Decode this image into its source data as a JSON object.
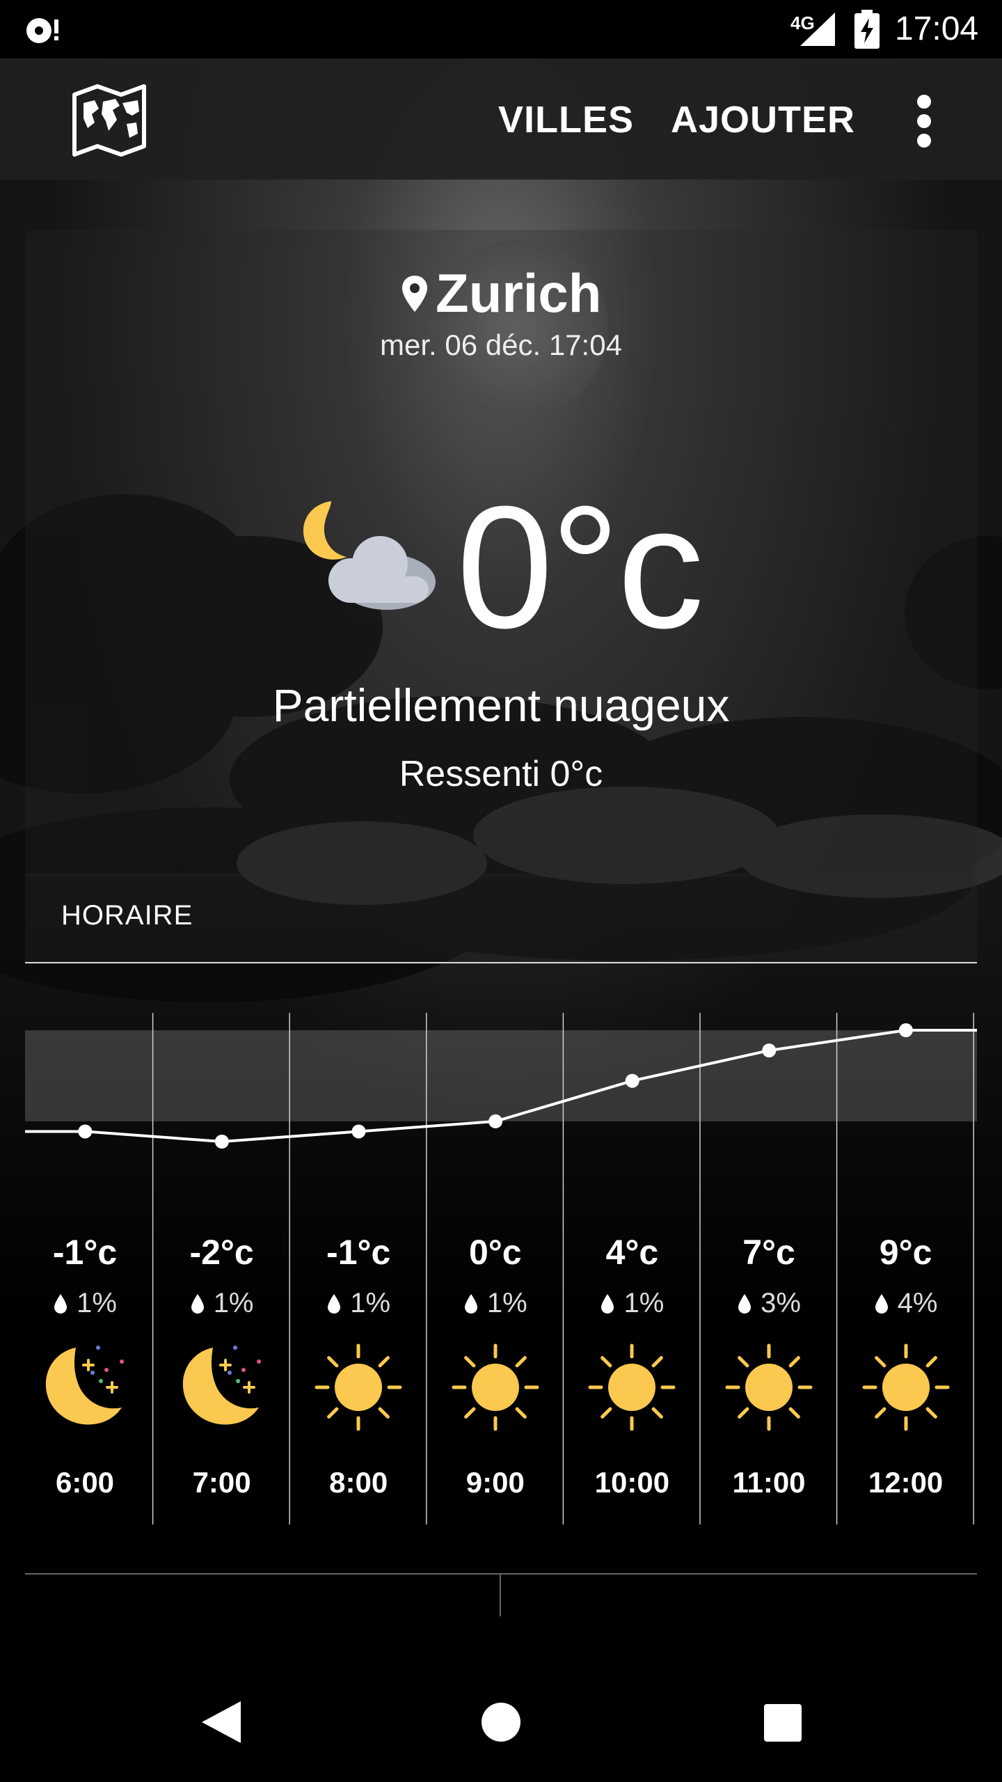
{
  "status_bar": {
    "network": "4G",
    "time": "17:04",
    "left_icon": "notification-disc-icon",
    "signal_icon": "cell-signal-icon",
    "battery_icon": "battery-charging-icon"
  },
  "app_bar": {
    "logo_icon": "world-map-icon",
    "nav_villes": "VILLES",
    "nav_ajouter": "AJOUTER",
    "menu_icon": "more-vert-icon"
  },
  "current": {
    "city": "Zurich",
    "datetime": "mer. 06 déc. 17:04",
    "temperature": "0°c",
    "condition": "Partiellement nuageux",
    "feels_like": "Ressenti 0°c",
    "condition_icon": "moon-cloud-icon"
  },
  "hourly": {
    "title": "HORAIRE",
    "items": [
      {
        "hour": "6:00",
        "temp": "-1°c",
        "precip": "1%",
        "icon": "moon-stars-icon"
      },
      {
        "hour": "7:00",
        "temp": "-2°c",
        "precip": "1%",
        "icon": "moon-stars-icon"
      },
      {
        "hour": "8:00",
        "temp": "-1°c",
        "precip": "1%",
        "icon": "sun-icon"
      },
      {
        "hour": "9:00",
        "temp": "0°c",
        "precip": "1%",
        "icon": "sun-icon"
      },
      {
        "hour": "10:00",
        "temp": "4°c",
        "precip": "1%",
        "icon": "sun-icon"
      },
      {
        "hour": "11:00",
        "temp": "7°c",
        "precip": "3%",
        "icon": "sun-icon"
      },
      {
        "hour": "12:00",
        "temp": "9°c",
        "precip": "4%",
        "icon": "sun-icon"
      }
    ]
  },
  "chart_data": {
    "type": "line",
    "x": [
      "6:00",
      "7:00",
      "8:00",
      "9:00",
      "10:00",
      "11:00",
      "12:00"
    ],
    "series": [
      {
        "values": [
          -1,
          -2,
          -1,
          0,
          4,
          7,
          9
        ]
      }
    ]
  },
  "colors": {
    "accent_sun": "#FBC94F",
    "cloud": "#C9CED8",
    "line": "#ffffff"
  },
  "nav_bar": {
    "back_icon": "back-icon",
    "home_icon": "home-icon",
    "recents_icon": "recents-icon"
  }
}
